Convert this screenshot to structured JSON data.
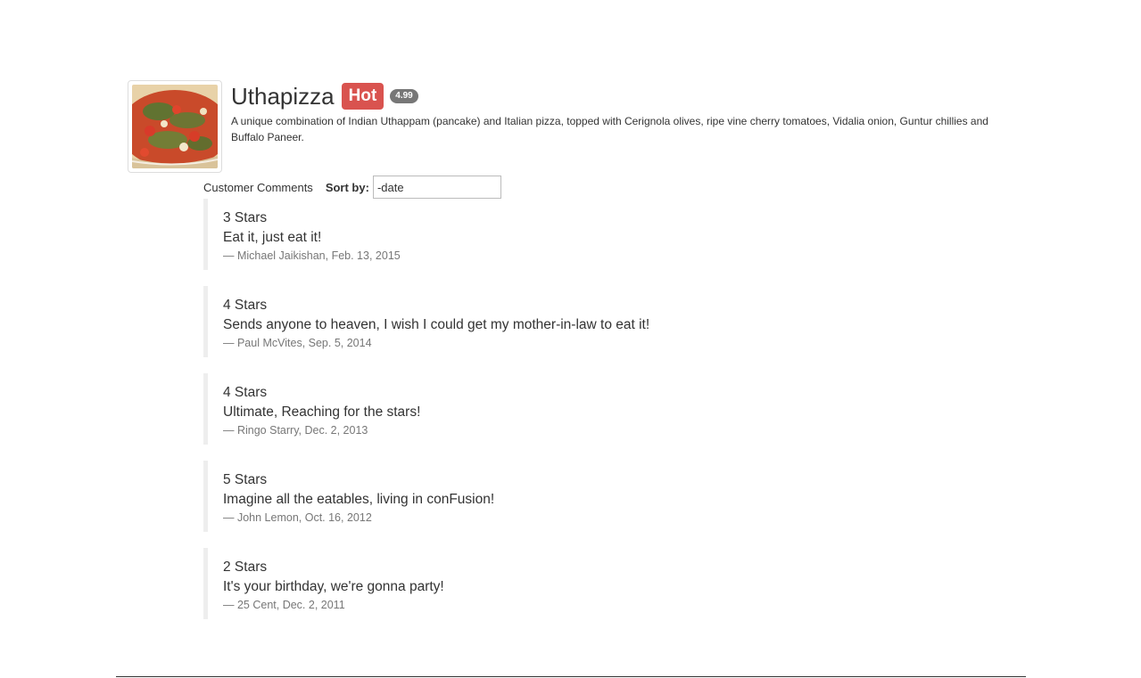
{
  "dish": {
    "name": "Uthapizza",
    "label": "Hot",
    "price": "4.99",
    "description": "A unique combination of Indian Uthappam (pancake) and Italian pizza, topped with Cerignola olives, ripe vine cherry tomatoes, Vidalia onion, Guntur chillies and Buffalo Paneer.",
    "image_icon": "pizza-photo"
  },
  "comments_section": {
    "title": "Customer Comments",
    "sort_label": "Sort by:",
    "sort_value": "-date"
  },
  "comments": [
    {
      "rating": "3 Stars",
      "text": "Eat it, just eat it!",
      "footer": "— Michael Jaikishan, Feb. 13, 2015"
    },
    {
      "rating": "4 Stars",
      "text": "Sends anyone to heaven, I wish I could get my mother-in-law to eat it!",
      "footer": "— Paul McVites, Sep. 5, 2014"
    },
    {
      "rating": "4 Stars",
      "text": "Ultimate, Reaching for the stars!",
      "footer": "— Ringo Starry, Dec. 2, 2013"
    },
    {
      "rating": "5 Stars",
      "text": "Imagine all the eatables, living in conFusion!",
      "footer": "— John Lemon, Oct. 16, 2012"
    },
    {
      "rating": "2 Stars",
      "text": "It's your birthday, we're gonna party!",
      "footer": "— 25 Cent, Dec. 2, 2011"
    }
  ],
  "colors": {
    "hot_label": "#d9534f",
    "price_badge": "#777777",
    "comment_border": "#eeeeee",
    "footer_text": "#777777"
  }
}
